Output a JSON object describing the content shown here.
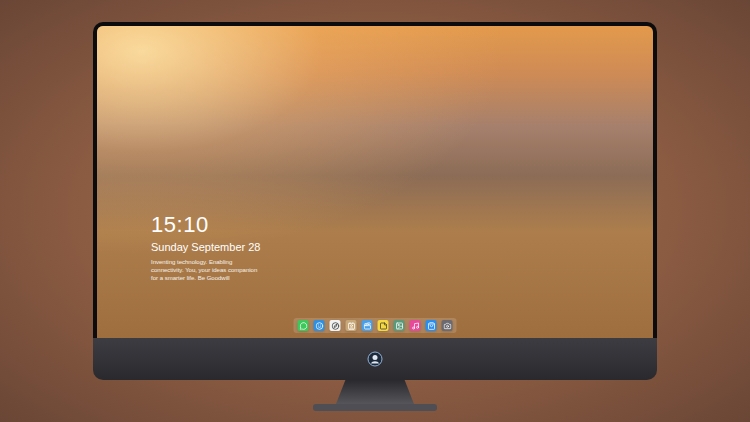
{
  "lock_screen": {
    "time": "15:10",
    "date": "Sunday September 28",
    "tagline": "Inventing technology. Enabling connectivity. You, your ideas companion for a smarter life. Be Goodwill"
  },
  "dock": {
    "items": [
      {
        "kind": "messages",
        "color": "#3cc85a"
      },
      {
        "kind": "finder",
        "color": "#2f8fe0"
      },
      {
        "kind": "safari",
        "color": "#f2f2f2"
      },
      {
        "kind": "contacts",
        "color": "#c8a878"
      },
      {
        "kind": "movies",
        "color": "#4aa0e8"
      },
      {
        "kind": "notes",
        "color": "#f5d742"
      },
      {
        "kind": "photos",
        "color": "#5a9a7a"
      },
      {
        "kind": "music",
        "color": "#e84a9a"
      },
      {
        "kind": "appstore",
        "color": "#2a8ef0"
      },
      {
        "kind": "camera",
        "color": "#6a6a70"
      }
    ]
  }
}
